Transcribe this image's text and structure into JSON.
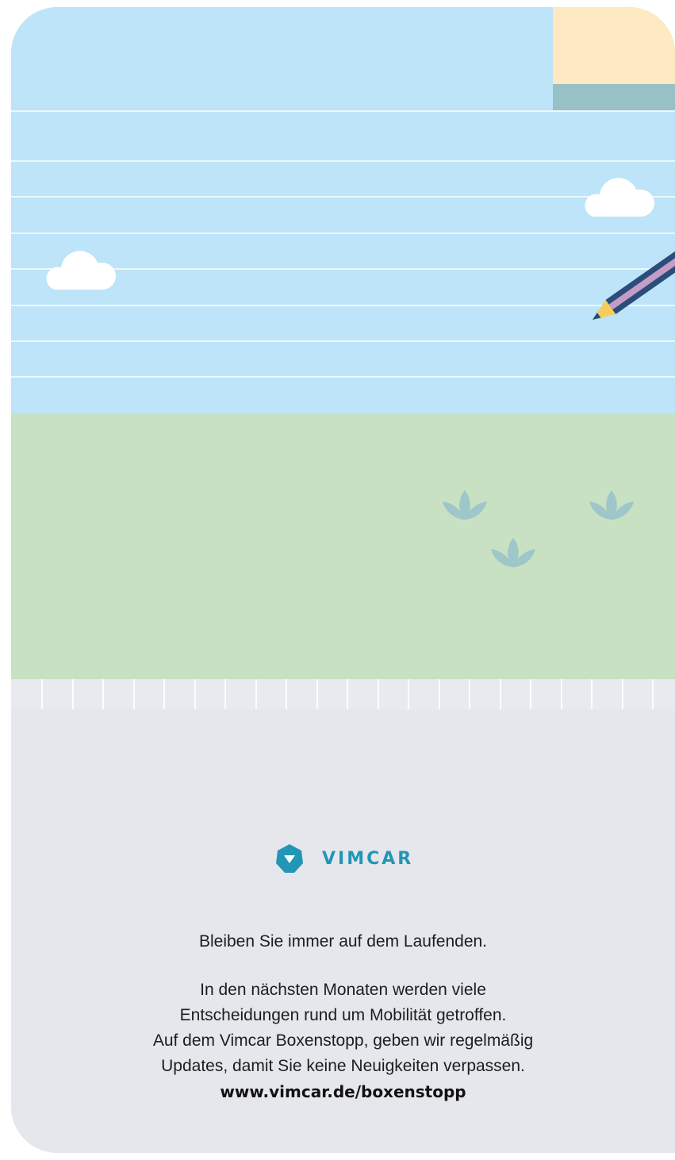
{
  "brand": {
    "name": "VIMCAR",
    "logo_icon": "chevron-down-hexagon-icon",
    "color": "#2196b6"
  },
  "illustration": {
    "sky_color": "#bde4f8",
    "grass_color": "#c9e1c3",
    "footer_color": "#e5e7ec",
    "elements": [
      "cloud-icon",
      "cloud-icon",
      "pencil-icon",
      "plant-icon",
      "plant-icon",
      "plant-icon",
      "sticky-note"
    ]
  },
  "footer": {
    "tagline": "Bleiben Sie immer auf dem Laufenden.",
    "body_lines": [
      "In den nächsten Monaten werden viele",
      "Entscheidungen rund um Mobilität getroffen.",
      "Auf dem Vimcar Boxenstopp, geben wir regelmäßig",
      "Updates, damit Sie keine Neuigkeiten verpassen."
    ],
    "link": "www.vimcar.de/boxenstopp"
  }
}
